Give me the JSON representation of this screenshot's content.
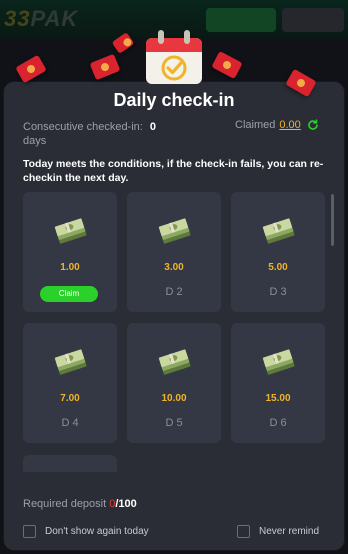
{
  "modal": {
    "title": "Daily check-in",
    "consecutive_label": "Consecutive checked-in:",
    "consecutive_value": "0",
    "consecutive_unit": "days",
    "claimed_label": "Claimed",
    "claimed_value": "0.00",
    "notice": "Today meets the conditions, if the check-in fails, you can re-checkin the next day.",
    "claim_button": "Claim",
    "days": [
      {
        "amount": "1.00",
        "label": "Claim",
        "claimable": true
      },
      {
        "amount": "3.00",
        "label": "D 2"
      },
      {
        "amount": "5.00",
        "label": "D 3"
      },
      {
        "amount": "7.00",
        "label": "D 4"
      },
      {
        "amount": "10.00",
        "label": "D 5"
      },
      {
        "amount": "15.00",
        "label": "D 6"
      }
    ],
    "deposit_label": "Required deposit",
    "deposit_current": "0",
    "deposit_required": "/100",
    "dont_show_label": "Don't show again today",
    "never_remind_label": "Never remind"
  },
  "colors": {
    "accent_gold": "#f0b429",
    "claim_green": "#2bd12b",
    "deposit_red": "#e83a3a",
    "modal_bg": "#2a2d35",
    "card_bg": "#343844"
  },
  "icons": [
    "calendar-check-icon",
    "red-envelope-icon",
    "refresh-icon",
    "money-stack-icon"
  ]
}
